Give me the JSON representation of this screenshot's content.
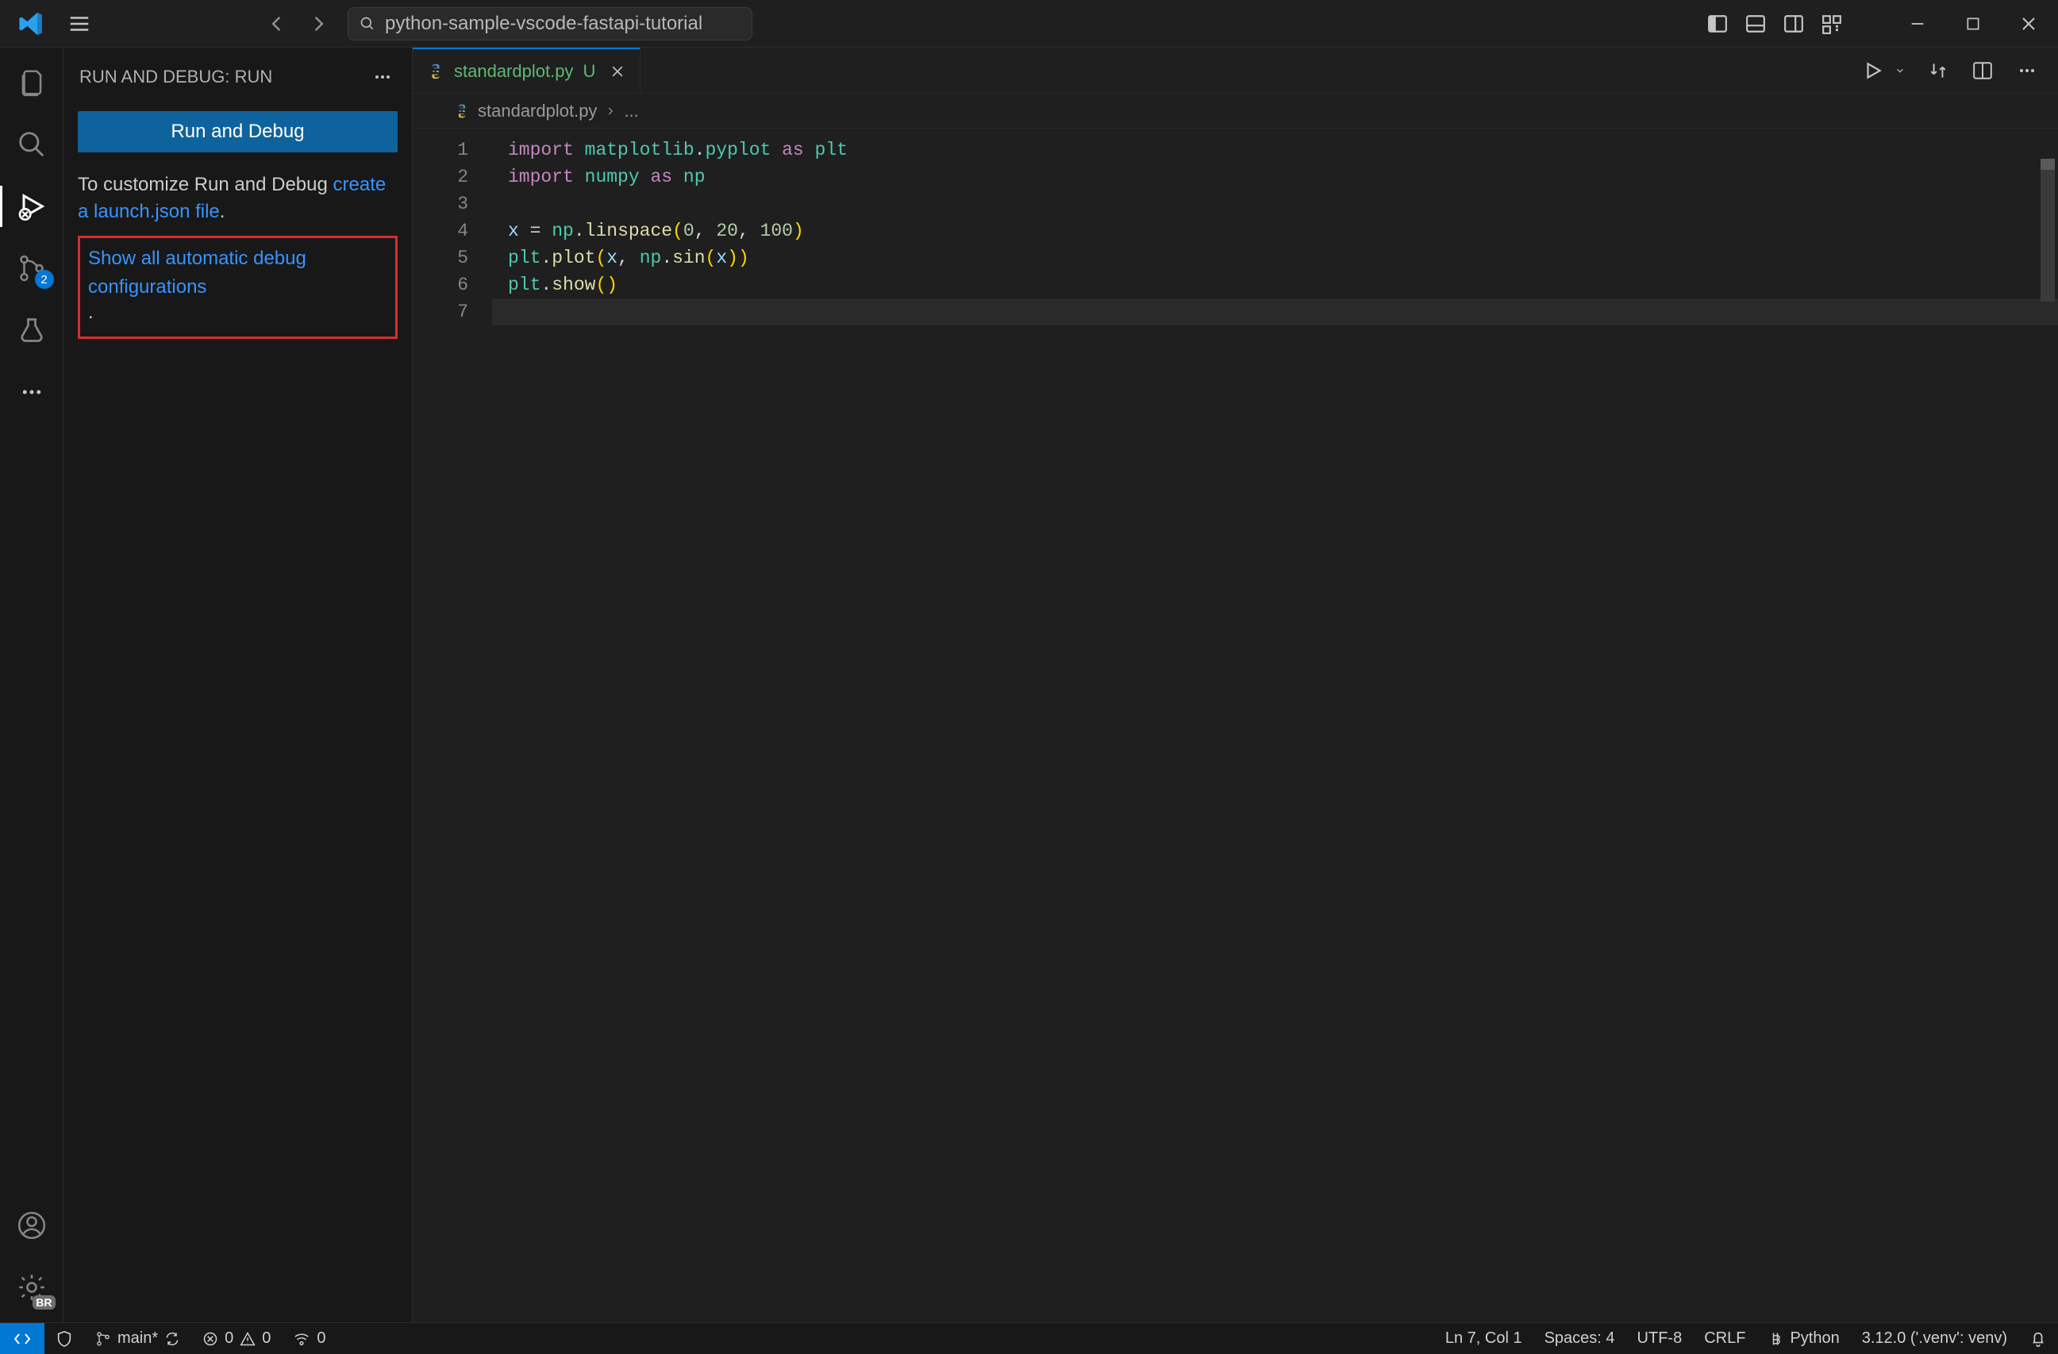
{
  "title": {
    "search_text": "python-sample-vscode-fastapi-tutorial"
  },
  "sidebar": {
    "header": "RUN AND DEBUG: RUN",
    "run_button": "Run and Debug",
    "customize_text": "To customize Run and Debug ",
    "create_launch_link": "create a launch.json file",
    "show_all_link": "Show all automatic debug configurations"
  },
  "activity": {
    "scm_badge": "2",
    "settings_badge": "BR"
  },
  "tabs": {
    "file_name": "standardplot.py",
    "modified_marker": "U"
  },
  "breadcrumb": {
    "file": "standardplot.py",
    "more": "..."
  },
  "code": {
    "line_numbers": [
      "1",
      "2",
      "3",
      "4",
      "5",
      "6",
      "7"
    ],
    "lines_tokens": [
      [
        [
          "kw",
          "import"
        ],
        [
          "sp",
          " "
        ],
        [
          "mod",
          "matplotlib"
        ],
        [
          "punc",
          "."
        ],
        [
          "mod",
          "pyplot"
        ],
        [
          "sp",
          " "
        ],
        [
          "kw",
          "as"
        ],
        [
          "sp",
          " "
        ],
        [
          "mod",
          "plt"
        ]
      ],
      [
        [
          "kw",
          "import"
        ],
        [
          "sp",
          " "
        ],
        [
          "mod",
          "numpy"
        ],
        [
          "sp",
          " "
        ],
        [
          "kw",
          "as"
        ],
        [
          "sp",
          " "
        ],
        [
          "mod",
          "np"
        ]
      ],
      [],
      [
        [
          "var",
          "x"
        ],
        [
          "sp",
          " "
        ],
        [
          "op",
          "="
        ],
        [
          "sp",
          " "
        ],
        [
          "mod",
          "np"
        ],
        [
          "punc",
          "."
        ],
        [
          "fn",
          "linspace"
        ],
        [
          "paren",
          "("
        ],
        [
          "num",
          "0"
        ],
        [
          "punc",
          ","
        ],
        [
          "sp",
          " "
        ],
        [
          "num",
          "20"
        ],
        [
          "punc",
          ","
        ],
        [
          "sp",
          " "
        ],
        [
          "num",
          "100"
        ],
        [
          "paren",
          ")"
        ]
      ],
      [
        [
          "mod",
          "plt"
        ],
        [
          "punc",
          "."
        ],
        [
          "fn",
          "plot"
        ],
        [
          "paren",
          "("
        ],
        [
          "var",
          "x"
        ],
        [
          "punc",
          ","
        ],
        [
          "sp",
          " "
        ],
        [
          "mod",
          "np"
        ],
        [
          "punc",
          "."
        ],
        [
          "fn",
          "sin"
        ],
        [
          "paren",
          "("
        ],
        [
          "var",
          "x"
        ],
        [
          "paren",
          "))"
        ]
      ],
      [
        [
          "mod",
          "plt"
        ],
        [
          "punc",
          "."
        ],
        [
          "fn",
          "show"
        ],
        [
          "paren",
          "()"
        ]
      ],
      []
    ],
    "current_line": 7
  },
  "status": {
    "branch": "main*",
    "errors": "0",
    "warnings": "0",
    "ports": "0",
    "cursor": "Ln 7, Col 1",
    "spaces": "Spaces: 4",
    "encoding": "UTF-8",
    "eol": "CRLF",
    "lang": "Python",
    "interpreter": "3.12.0 ('.venv': venv)"
  }
}
